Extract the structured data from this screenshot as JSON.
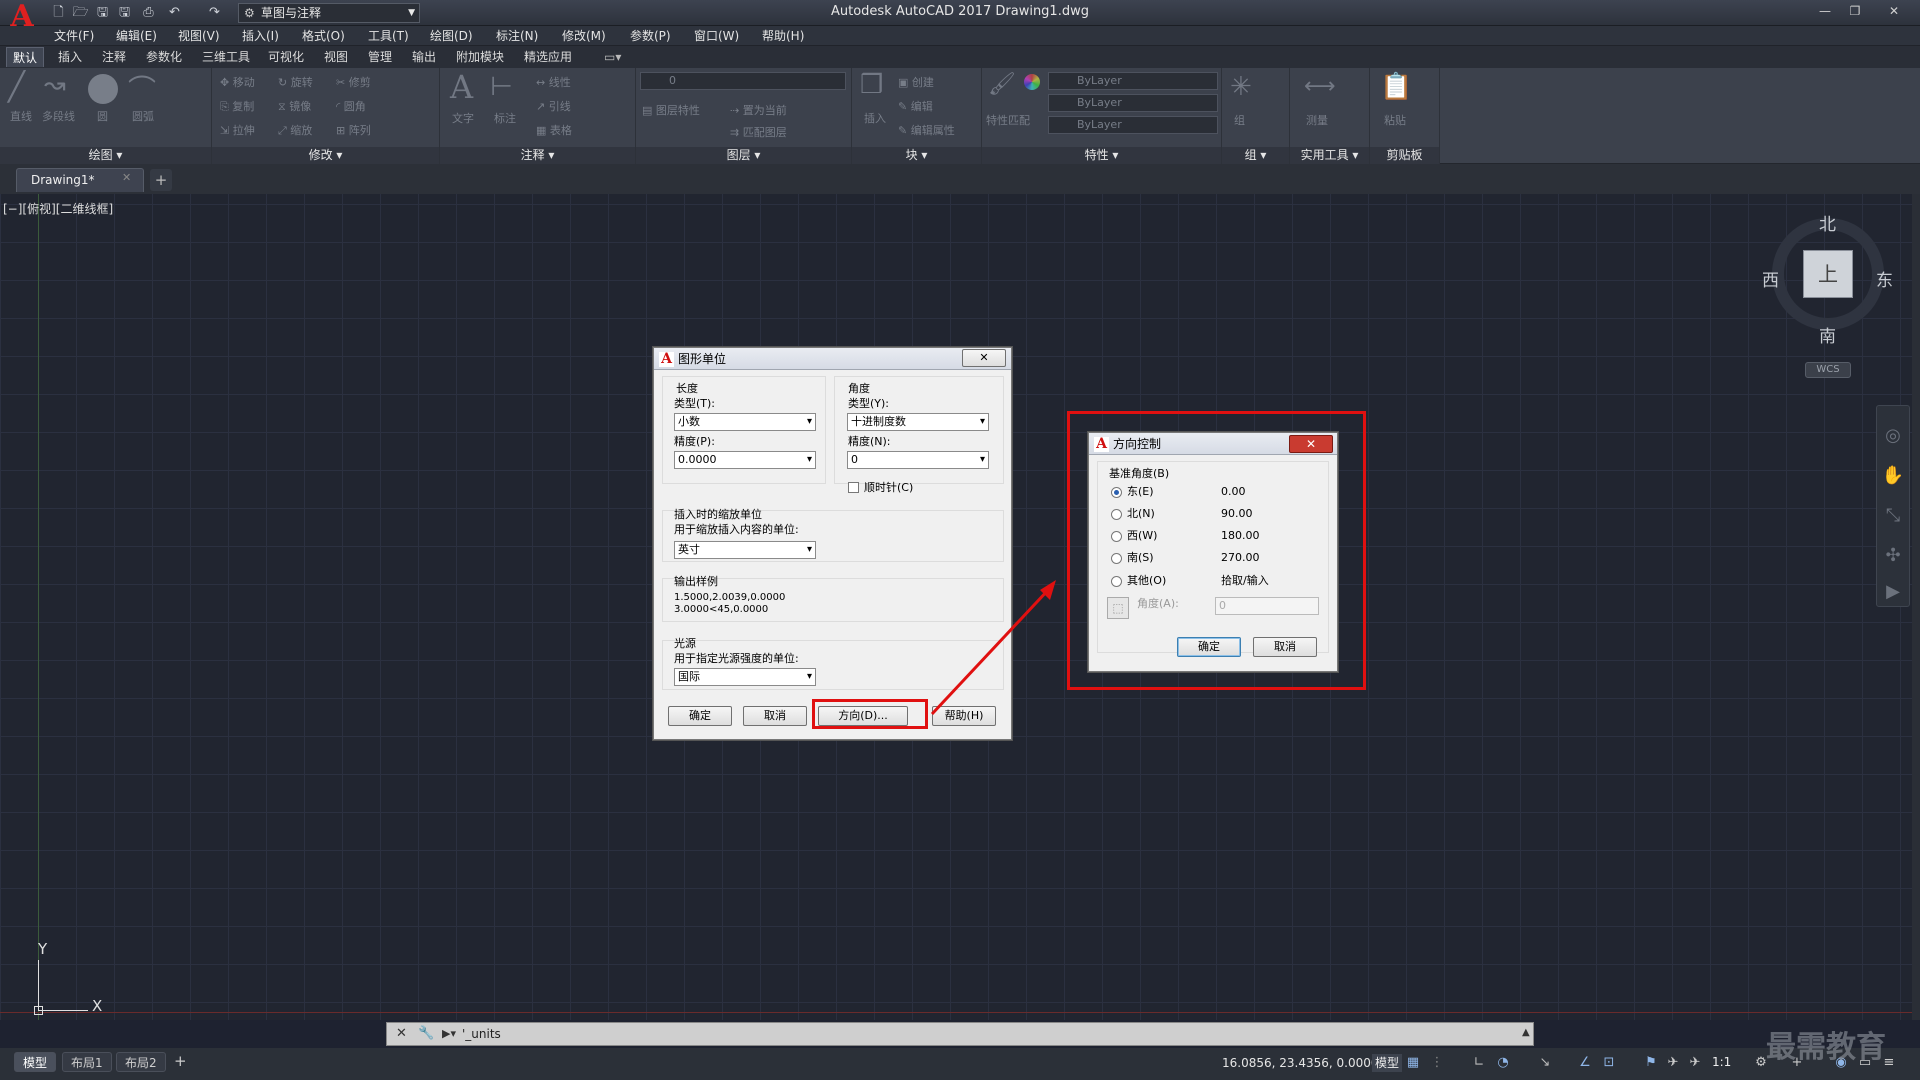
{
  "window": {
    "title": "Autodesk AutoCAD 2017    Drawing1.dwg",
    "workspace": "草图与注释",
    "minimize": "—",
    "restore": "❐",
    "close": "✕"
  },
  "menu": [
    "文件(F)",
    "编辑(E)",
    "视图(V)",
    "插入(I)",
    "格式(O)",
    "工具(T)",
    "绘图(D)",
    "标注(N)",
    "修改(M)",
    "参数(P)",
    "窗口(W)",
    "帮助(H)"
  ],
  "ribbon_tabs": [
    "默认",
    "插入",
    "注释",
    "参数化",
    "三维工具",
    "可视化",
    "视图",
    "管理",
    "输出",
    "附加模块",
    "精选应用"
  ],
  "ribbon_panels": [
    "绘图",
    "修改",
    "注释",
    "图层",
    "块",
    "特性",
    "组",
    "实用工具",
    "剪贴板"
  ],
  "ribbon": {
    "draw_labels": [
      "直线",
      "多段线",
      "圆",
      "圆弧"
    ],
    "modify_labels": [
      "移动",
      "旋转",
      "修剪",
      "复制",
      "镜像",
      "圆角",
      "拉伸",
      "缩放",
      "阵列"
    ],
    "annot_labels": [
      "文字",
      "标注",
      "线性",
      "引线",
      "表格"
    ],
    "layer_value": "0",
    "layer_labels": [
      "图层特性",
      "置为当前",
      "匹配图层"
    ],
    "block_labels": [
      "插入",
      "创建",
      "编辑",
      "编辑属性"
    ],
    "props": [
      "ByLayer",
      "ByLayer",
      "ByLayer"
    ],
    "prop_labels": [
      "特性匹配"
    ],
    "group_labels": [
      "组"
    ],
    "util_labels": [
      "测量"
    ],
    "clip_labels": [
      "粘贴"
    ]
  },
  "doc_tab": "Drawing1*",
  "viewport_label": "[−][俯视][二维线框]",
  "viewcube": {
    "top": "上",
    "north": "北",
    "south": "南",
    "east": "东",
    "west": "西",
    "wcs": "WCS"
  },
  "ucs": {
    "x": "X",
    "y": "Y"
  },
  "units_dialog": {
    "title": "图形单位",
    "length_group": "长度",
    "length_type_label": "类型(T):",
    "length_type": "小数",
    "length_precision_label": "精度(P):",
    "length_precision": "0.0000",
    "angle_group": "角度",
    "angle_type_label": "类型(Y):",
    "angle_type": "十进制度数",
    "angle_precision_label": "精度(N):",
    "angle_precision": "0",
    "clockwise": "顺时针(C)",
    "insert_group": "插入时的缩放单位",
    "insert_label": "用于缩放插入内容的单位:",
    "insert_unit": "英寸",
    "output_group": "输出样例",
    "output_line1": "1.5000,2.0039,0.0000",
    "output_line2": "3.0000<45,0.0000",
    "light_group": "光源",
    "light_label": "用于指定光源强度的单位:",
    "light_unit": "国际",
    "ok": "确定",
    "cancel": "取消",
    "direction": "方向(D)...",
    "help": "帮助(H)"
  },
  "direction_dialog": {
    "title": "方向控制",
    "group": "基准角度(B)",
    "options": [
      {
        "label": "东(E)",
        "value": "0.00",
        "selected": true
      },
      {
        "label": "北(N)",
        "value": "90.00",
        "selected": false
      },
      {
        "label": "西(W)",
        "value": "180.00",
        "selected": false
      },
      {
        "label": "南(S)",
        "value": "270.00",
        "selected": false
      },
      {
        "label": "其他(O)",
        "value": "拾取/输入",
        "selected": false
      }
    ],
    "angle_label": "角度(A):",
    "angle_value": "0",
    "ok": "确定",
    "cancel": "取消"
  },
  "command_line": "'_units",
  "layout_tabs": [
    "模型",
    "布局1",
    "布局2"
  ],
  "status": {
    "coords": "16.0856, 23.4356, 0.0000",
    "model": "模型",
    "scale": "1:1"
  },
  "watermark": "最需教育",
  "colors": {
    "highlight": "#e01010",
    "canvas": "#212530",
    "grid": "#2b3040"
  }
}
